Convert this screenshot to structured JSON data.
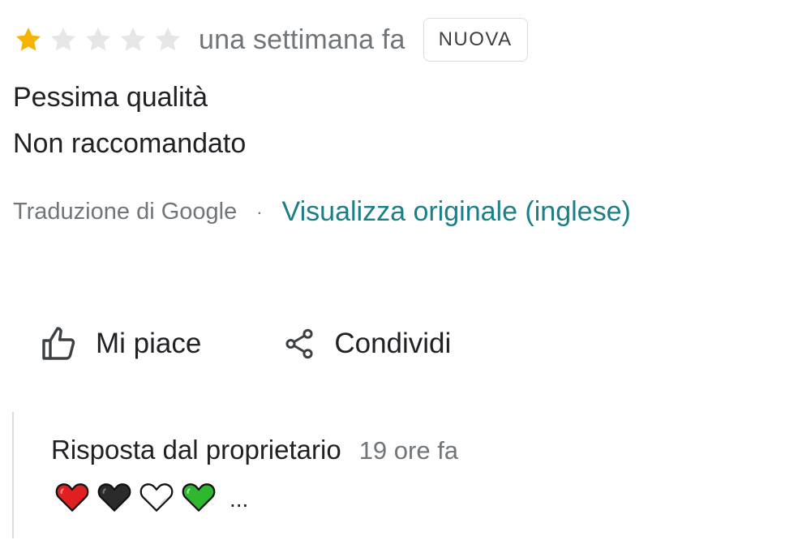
{
  "review": {
    "rating": 1,
    "rating_max": 5,
    "time_ago": "una settimana fa",
    "badge": "NUOVA",
    "text_lines": [
      "Pessima qualità",
      "Non raccomandato"
    ],
    "translation": {
      "translated_by": "Traduzione di Google",
      "separator": "·",
      "view_original": "Visualizza originale (inglese)"
    }
  },
  "actions": {
    "like_label": "Mi piace",
    "share_label": "Condividi"
  },
  "owner_reply": {
    "title": "Risposta dal proprietario",
    "time_ago": "19 ore fa",
    "hearts": [
      "red",
      "black",
      "white",
      "green"
    ],
    "ellipsis": "..."
  },
  "colors": {
    "star_filled": "#f5b400",
    "star_empty": "#e8e8e8",
    "link": "#1a7f87",
    "secondary_text": "#70757a",
    "heart_red": "#e02020",
    "heart_black": "#2b2b2b",
    "heart_white": "#ffffff",
    "heart_green": "#2fb82f"
  },
  "icons": {
    "like": "thumb-up-icon",
    "share": "share-icon"
  }
}
